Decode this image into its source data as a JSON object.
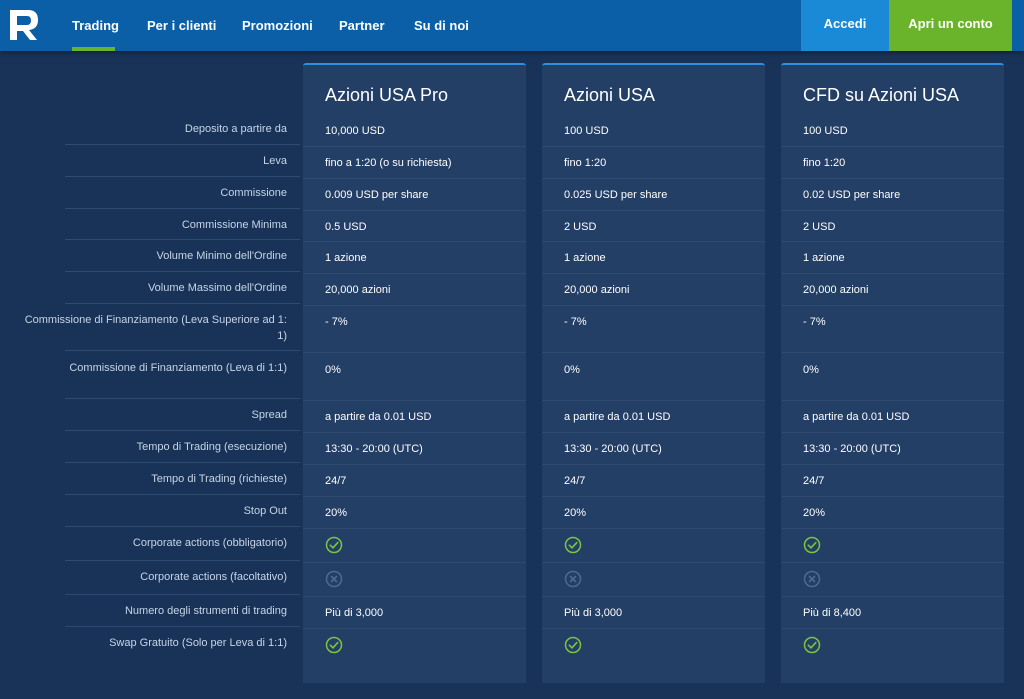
{
  "header": {
    "logo": "rs-logo",
    "nav": [
      "Trading",
      "Per i clienti",
      "Promozioni",
      "Partner",
      "Su di noi"
    ],
    "login_label": "Accedi",
    "open_account_label": "Apri un conto",
    "colors": {
      "bar": "#0a5fa7",
      "accent_green": "#69b52f",
      "login_bg": "#1a8ad6"
    }
  },
  "table": {
    "row_labels": [
      "Deposito a partire da",
      "Leva",
      "Commissione",
      "Commissione Minima",
      "Volume Minimo dell'Ordine",
      "Volume Massimo dell'Ordine",
      "Commissione di Finanziamento (Leva Superiore ad 1: 1)",
      "Commissione di Finanziamento (Leva di 1:1)",
      "Spread",
      "Tempo di Trading (esecuzione)",
      "Tempo di Trading (richieste)",
      "Stop Out",
      "Corporate actions (obbligatorio)",
      "Corporate actions (facoltativo)",
      "Numero degli strumenti di trading",
      "Swap Gratuito (Solo per Leva di 1:1)"
    ],
    "columns": [
      {
        "title": "Azioni USA Pro",
        "values": [
          "10,000 USD",
          "fino a 1:20 (o su richiesta)",
          "0.009 USD per share",
          "0.5 USD",
          "1 azione",
          "20,000 azioni",
          "- 7%",
          "0%",
          "a partire da 0.01 USD",
          "13:30 - 20:00 (UTC)",
          "24/7",
          "20%",
          "check-icon",
          "cross-icon",
          "Più di 3,000",
          "check-icon"
        ]
      },
      {
        "title": "Azioni USA",
        "values": [
          "100 USD",
          "fino 1:20",
          "0.025 USD per share",
          "2 USD",
          "1 azione",
          "20,000 azioni",
          "- 7%",
          "0%",
          "a partire da 0.01 USD",
          "13:30 - 20:00 (UTC)",
          "24/7",
          "20%",
          "check-icon",
          "cross-icon",
          "Più di 3,000",
          "check-icon"
        ]
      },
      {
        "title": "CFD su Azioni USA",
        "values": [
          "100 USD",
          "fino 1:20",
          "0.02 USD per share",
          "2 USD",
          "1 azione",
          "20,000 azioni",
          "- 7%",
          "0%",
          "a partire da 0.01 USD",
          "13:30 - 20:00 (UTC)",
          "24/7",
          "20%",
          "check-icon",
          "cross-icon",
          "Più di 8,400",
          "check-icon"
        ]
      }
    ],
    "colors": {
      "check": "#7cc441",
      "cross": "#4d6a8f"
    }
  }
}
